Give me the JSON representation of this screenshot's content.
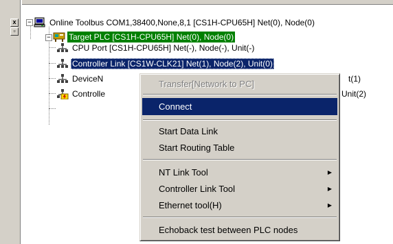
{
  "left_strip": {
    "close_glyph": "x",
    "pin_glyph": "▫"
  },
  "tree": {
    "root": {
      "label": "Online Toolbus COM1,38400,None,8,1 [CS1H-CPU65H] Net(0), Node(0)",
      "icon": "computer-icon",
      "expander": "−"
    },
    "plc": {
      "label": "Target PLC [CS1H-CPU65H] Net(0), Node(0)",
      "icon": "plc-icon",
      "expander": "−",
      "highlight_color": "#008000"
    },
    "children": [
      {
        "label": "CPU Port [CS1H-CPU65H] Net(-), Node(-), Unit(-)",
        "icon": "network-port-icon"
      },
      {
        "label": "Controller Link [CS1W-CLK21] Net(1), Node(2), Unit(0)",
        "icon": "network-port-icon",
        "selected": true
      },
      {
        "label_visible_start": "DeviceN",
        "label_visible_end": "t(1)",
        "icon": "network-port-icon"
      },
      {
        "label_visible_start": "Controlle",
        "label_visible_end": "Unit(2)",
        "icon": "network-port-warning-icon"
      }
    ]
  },
  "context_menu": {
    "items": [
      {
        "label": "Transfer[Network to PC]",
        "disabled": true
      },
      {
        "label": "Connect",
        "hovered": true
      },
      {
        "label": "Start Data Link"
      },
      {
        "label": "Start Routing Table"
      },
      {
        "label": "NT Link Tool",
        "submenu": true
      },
      {
        "label": "Controller Link Tool",
        "submenu": true
      },
      {
        "label": "Ethernet tool(H)",
        "submenu": true
      },
      {
        "label": "Echoback test between PLC nodes"
      }
    ],
    "submenu_arrow": "▶"
  },
  "colors": {
    "selection_blue": "#0a246a",
    "selection_green": "#008000",
    "face": "#d4d0c8"
  }
}
